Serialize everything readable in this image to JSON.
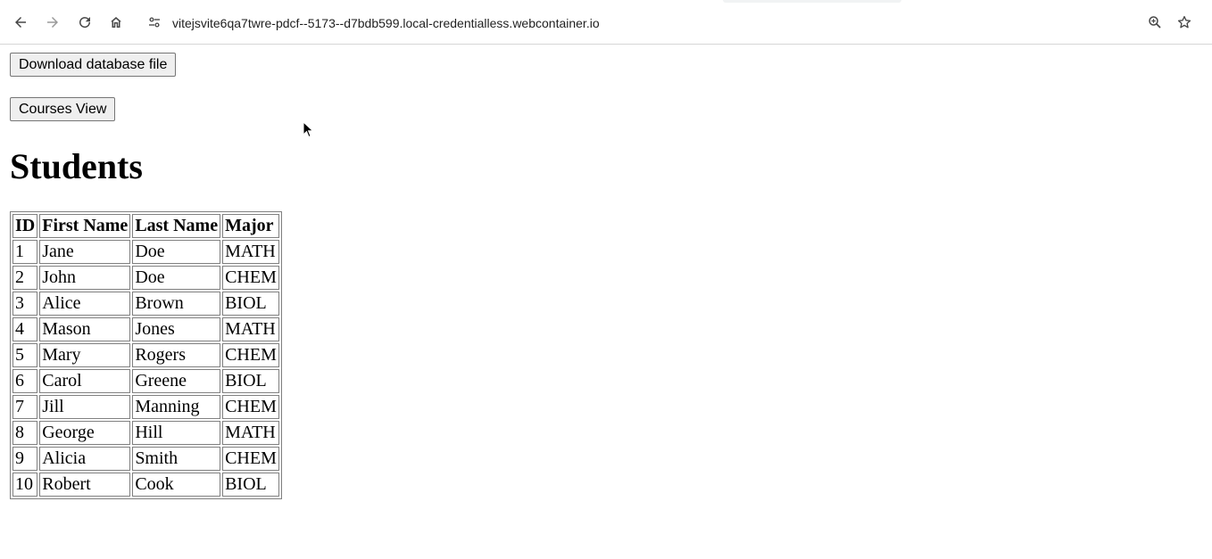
{
  "browser": {
    "url": "vitejsvite6qa7twre-pdcf--5173--d7bdb599.local-credentialless.webcontainer.io",
    "icons": [
      "back-icon",
      "forward-icon",
      "reload-icon",
      "home-icon",
      "site-settings-icon",
      "zoom-icon",
      "bookmark-star-icon"
    ]
  },
  "page": {
    "download_button": "Download database file",
    "courses_button": "Courses View",
    "heading": "Students"
  },
  "table": {
    "headers": [
      "ID",
      "First Name",
      "Last Name",
      "Major"
    ],
    "rows": [
      [
        "1",
        "Jane",
        "Doe",
        "MATH"
      ],
      [
        "2",
        "John",
        "Doe",
        "CHEM"
      ],
      [
        "3",
        "Alice",
        "Brown",
        "BIOL"
      ],
      [
        "4",
        "Mason",
        "Jones",
        "MATH"
      ],
      [
        "5",
        "Mary",
        "Rogers",
        "CHEM"
      ],
      [
        "6",
        "Carol",
        "Greene",
        "BIOL"
      ],
      [
        "7",
        "Jill",
        "Manning",
        "CHEM"
      ],
      [
        "8",
        "George",
        "Hill",
        "MATH"
      ],
      [
        "9",
        "Alicia",
        "Smith",
        "CHEM"
      ],
      [
        "10",
        "Robert",
        "Cook",
        "BIOL"
      ]
    ]
  }
}
